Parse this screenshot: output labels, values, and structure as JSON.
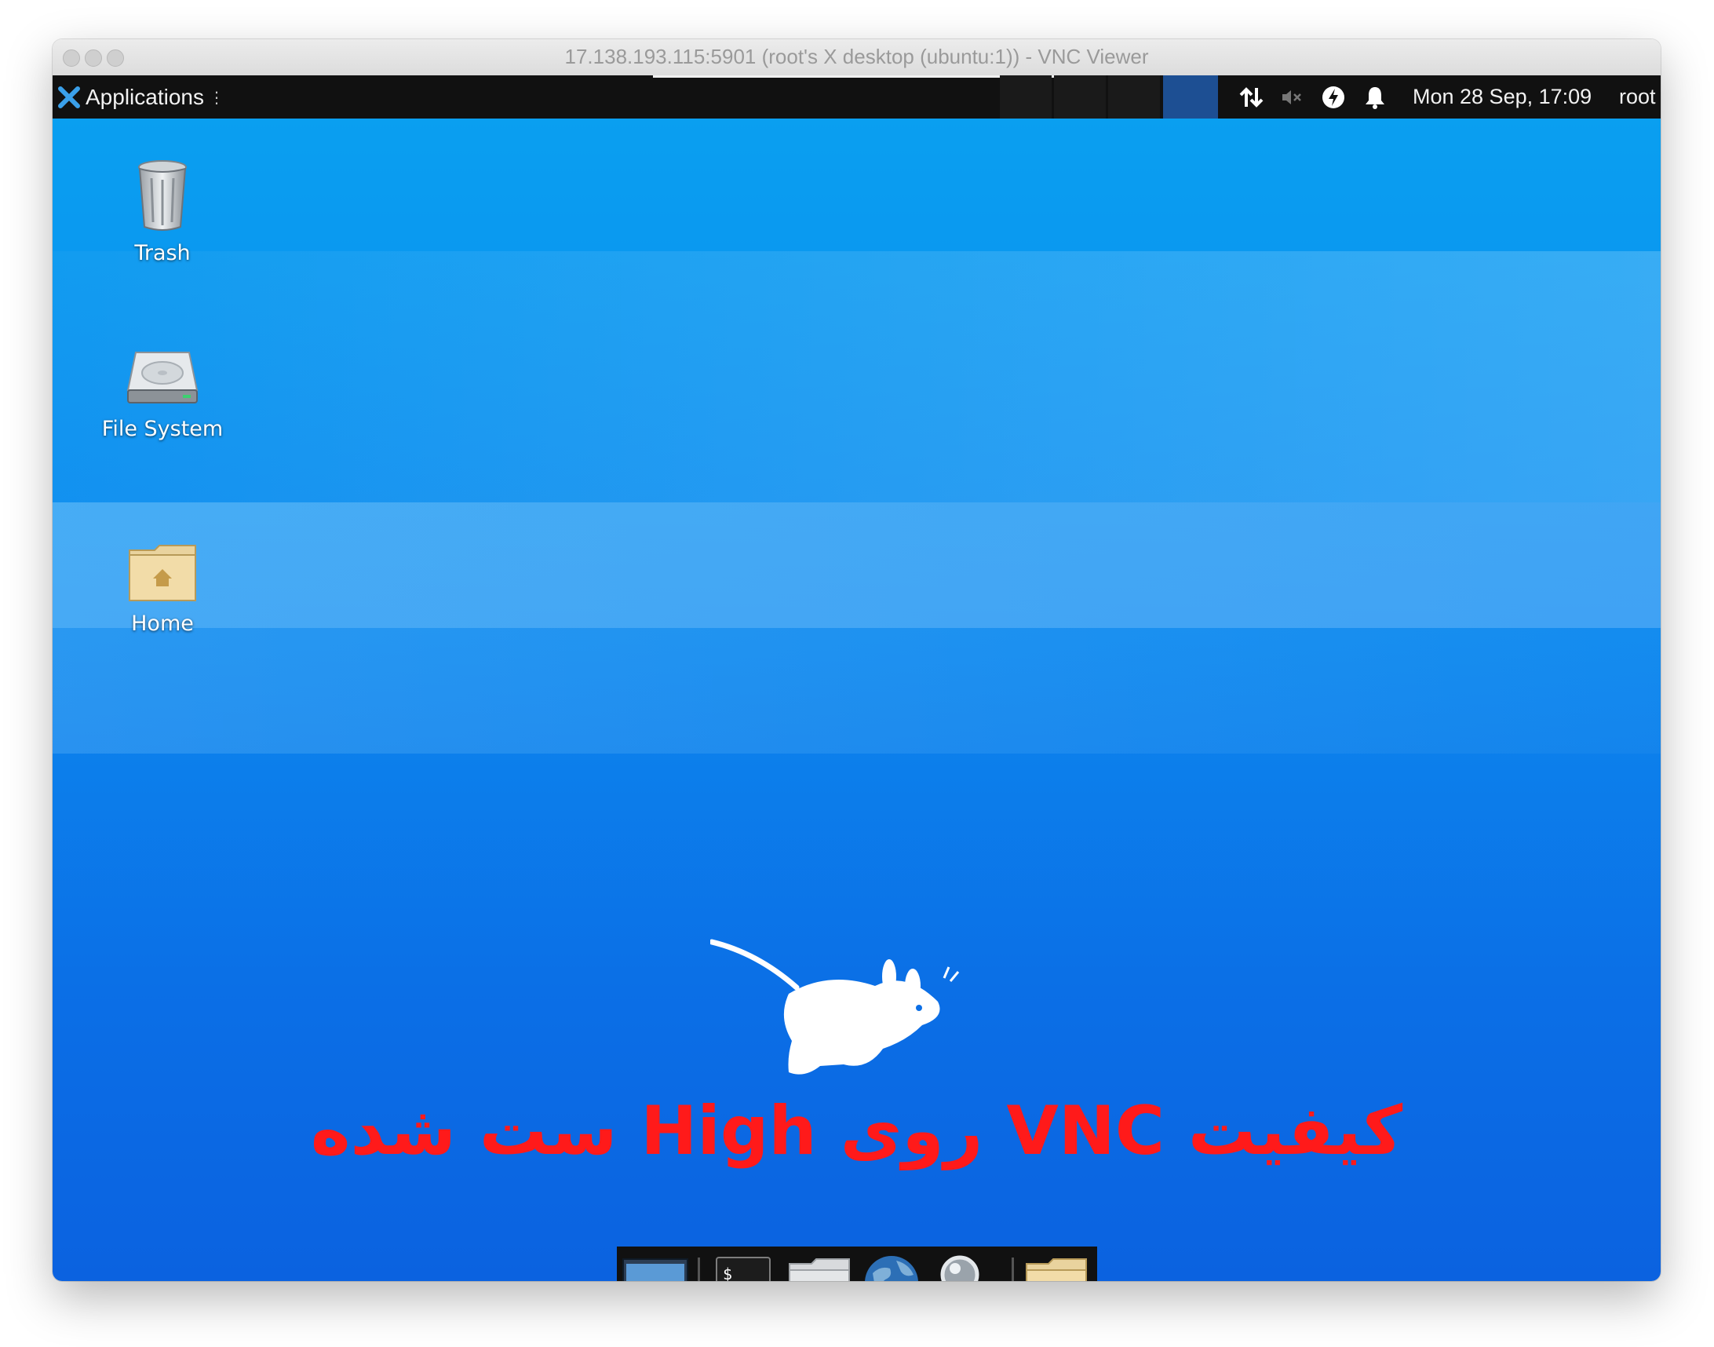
{
  "window": {
    "title": "17.138.193.115:5901 (root's X desktop (ubuntu:1)) - VNC Viewer"
  },
  "panel": {
    "applications_label": "Applications",
    "clock": "Mon 28 Sep, 17:09",
    "user": "root",
    "tray_icons": [
      "network-icon",
      "volume-muted-icon",
      "power-icon",
      "notification-bell-icon"
    ]
  },
  "desktop": {
    "icons": [
      {
        "label": "Trash",
        "icon": "trash-icon"
      },
      {
        "label": "File System",
        "icon": "hard-drive-icon"
      },
      {
        "label": "Home",
        "icon": "home-folder-icon"
      }
    ],
    "caption": "کیفیت VNC روی High ست شده",
    "caption_color": "#ff1a1a",
    "background_colors": [
      "#0a9ff0",
      "#0b62e0"
    ]
  },
  "dock": {
    "items": [
      "show-desktop-icon",
      "terminal-icon",
      "home-folder-icon",
      "web-browser-icon",
      "search-icon",
      "folder-icon"
    ]
  }
}
